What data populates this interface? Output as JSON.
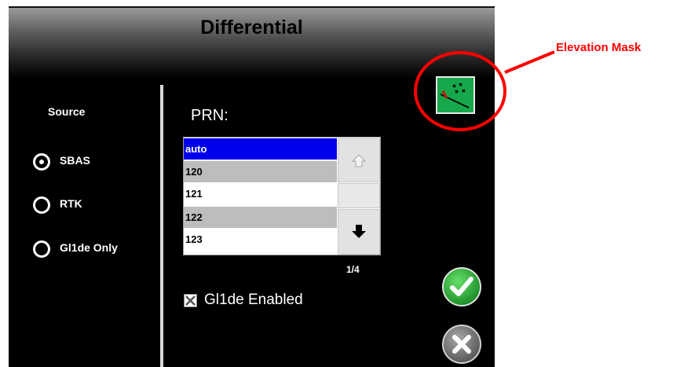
{
  "header": {
    "title": "Differential"
  },
  "source": {
    "label": "Source",
    "options": [
      {
        "label": "SBAS",
        "selected": true
      },
      {
        "label": "RTK",
        "selected": false
      },
      {
        "label": "Gl1de Only",
        "selected": false
      }
    ]
  },
  "prn": {
    "label": "PRN:",
    "items": [
      "auto",
      "120",
      "121",
      "122",
      "123"
    ],
    "selected_index": 0,
    "page_indicator": "1/4"
  },
  "glide": {
    "label": "Gl1de Enabled",
    "checked": true
  },
  "annotation": {
    "label": "Elevation Mask",
    "color": "#ff0000"
  },
  "icons": {
    "elevation_mask": "elevation-mask-icon",
    "scroll_up": "arrow-up-icon",
    "scroll_down": "arrow-down-icon",
    "ok": "checkmark-icon",
    "cancel": "x-icon"
  },
  "colors": {
    "accent_green": "#16a84a",
    "selection_blue": "#0000ee"
  }
}
